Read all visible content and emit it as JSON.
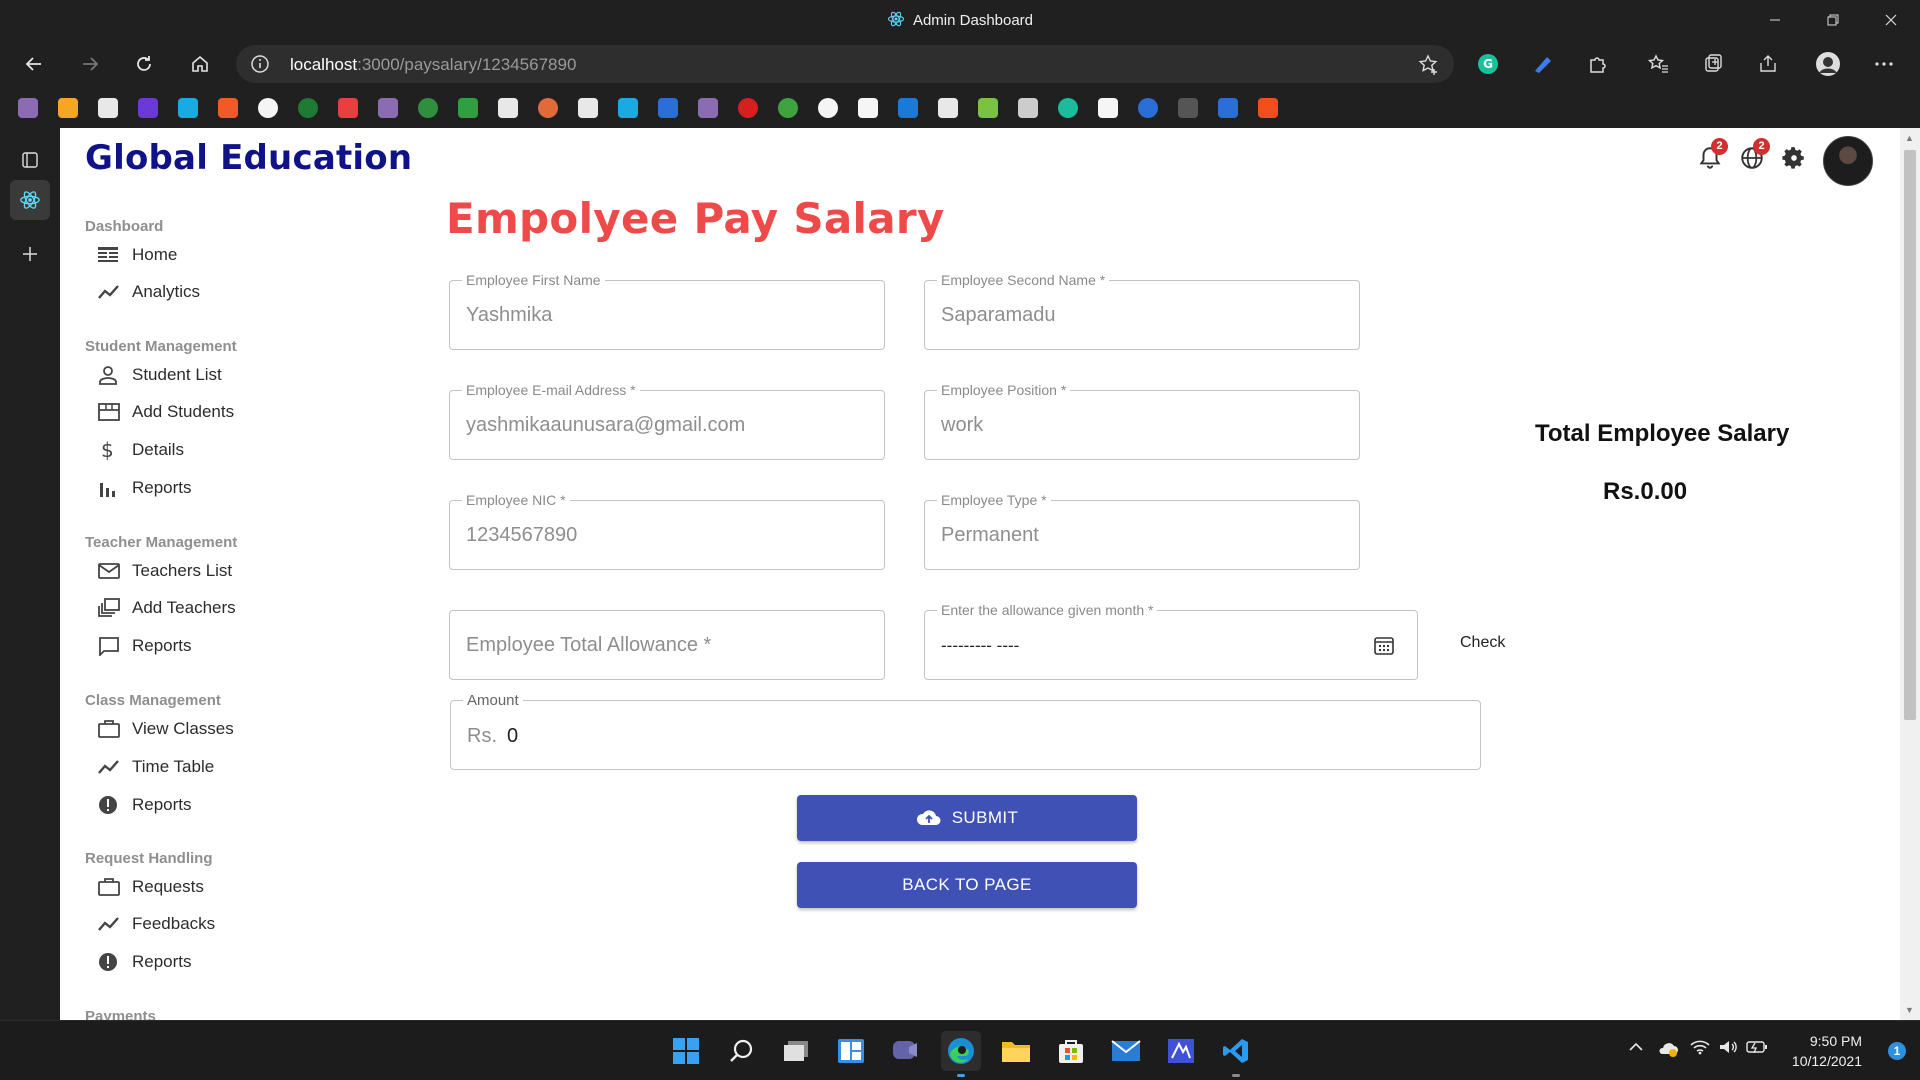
{
  "window": {
    "title": "Admin Dashboard"
  },
  "browser": {
    "url_host": "localhost",
    "url_path": ":3000/paysalary/1234567890"
  },
  "header": {
    "brand": "Global Education",
    "notifications_count": "2",
    "language_count": "2"
  },
  "sidebar": {
    "sections": [
      {
        "title": "Dashboard",
        "items": [
          {
            "label": "Home",
            "icon": "dashboard-icon"
          },
          {
            "label": "Analytics",
            "icon": "timeline-icon"
          }
        ]
      },
      {
        "title": "Student Management",
        "items": [
          {
            "label": "Student List",
            "icon": "person-icon"
          },
          {
            "label": "Add Students",
            "icon": "storefront-icon"
          },
          {
            "label": "Details",
            "icon": "dollar-icon"
          },
          {
            "label": "Reports",
            "icon": "bar-chart-icon"
          }
        ]
      },
      {
        "title": "Teacher Management",
        "items": [
          {
            "label": "Teachers List",
            "icon": "mail-icon"
          },
          {
            "label": "Add Teachers",
            "icon": "dynamic-feed-icon"
          },
          {
            "label": "Reports",
            "icon": "chat-bubble-icon"
          }
        ]
      },
      {
        "title": "Class Management",
        "items": [
          {
            "label": "View Classes",
            "icon": "work-icon"
          },
          {
            "label": "Time Table",
            "icon": "timeline-icon"
          },
          {
            "label": "Reports",
            "icon": "report-icon"
          }
        ]
      },
      {
        "title": "Request Handling",
        "items": [
          {
            "label": "Requests",
            "icon": "work-icon"
          },
          {
            "label": "Feedbacks",
            "icon": "timeline-icon"
          },
          {
            "label": "Reports",
            "icon": "report-icon"
          }
        ]
      },
      {
        "title": "Payments",
        "items": []
      }
    ]
  },
  "form": {
    "title": "Empolyee Pay Salary",
    "first_name": {
      "label": "Employee First Name",
      "value": "Yashmika"
    },
    "second_name": {
      "label": "Employee Second Name *",
      "value": "Saparamadu"
    },
    "email": {
      "label": "Employee E-mail Address *",
      "value": "yashmikaaunusara@gmail.com"
    },
    "position": {
      "label": "Employee Position *",
      "value": "work"
    },
    "nic": {
      "label": "Employee NIC *",
      "value": "1234567890"
    },
    "type": {
      "label": "Employee Type *",
      "value": "Permanent"
    },
    "allowance": {
      "placeholder": "Employee Total Allowance *"
    },
    "month": {
      "label": "Enter the allowance given month *",
      "value": "--------- ----"
    },
    "check_label": "Check",
    "amount": {
      "label": "Amount",
      "prefix": "Rs.",
      "value": "0"
    },
    "submit_label": "SUBMIT",
    "back_label": "BACK TO PAGE"
  },
  "summary": {
    "title": "Total Employee Salary",
    "value": "Rs.0.00"
  },
  "taskbar": {
    "time": "9:50 PM",
    "date": "10/12/2021",
    "notifications": "1"
  },
  "colors": {
    "brand": "#0f1387",
    "title": "#ef4a4a",
    "primary_button": "#3f51b5",
    "badge": "#d32f2f"
  }
}
